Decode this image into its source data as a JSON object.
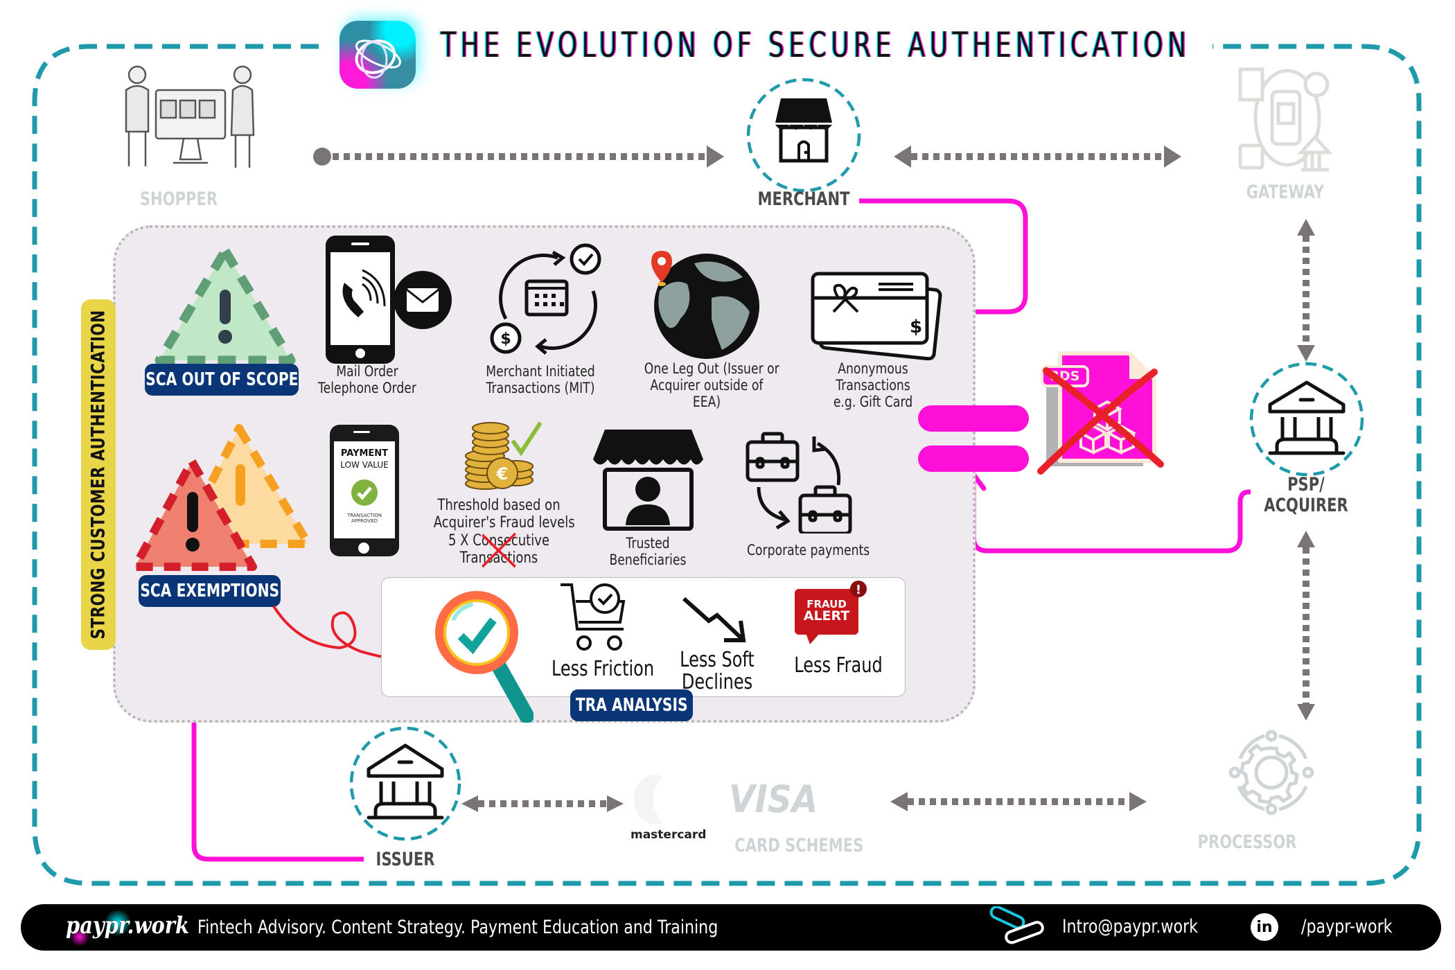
{
  "title": "THE EVOLUTION OF SECURE AUTHENTICATION",
  "colors": {
    "frame_teal": "#1f9aab",
    "flow_magenta": "#ff10d8",
    "badge_navy": "#0a3577",
    "sca_yellow": "#e8d548",
    "panel_bg": "#efeaf0",
    "faded_grey": "#cfd4d6",
    "arrow_grey": "#7a7474",
    "cross_red": "#e8202a"
  },
  "nodes": {
    "shopper": {
      "label": "SHOPPER",
      "icon": "shopper-icon",
      "state": "faded"
    },
    "merchant": {
      "label": "MERCHANT",
      "icon": "storefront-icon",
      "state": "active"
    },
    "gateway": {
      "label": "GATEWAY",
      "icon": "gateway-icon",
      "state": "faded"
    },
    "psp_acquirer": {
      "label_line1": "PSP/",
      "label_line2": "ACQUIRER",
      "icon": "bank-icon",
      "state": "active"
    },
    "processor": {
      "label": "PROCESSOR",
      "icon": "gear-cycle-icon",
      "state": "faded"
    },
    "card_schemes": {
      "label": "CARD SCHEMES",
      "mastercard": "mastercard",
      "visa": "VISA",
      "state": "faded"
    },
    "issuer": {
      "label": "ISSUER",
      "icon": "bank-icon",
      "state": "active"
    }
  },
  "sca": {
    "side_label": "STRONG CUSTOMER AUTHENTICATION",
    "out_of_scope": {
      "badge": "SCA OUT OF SCOPE",
      "items": [
        {
          "icon": "phone-mail-icon",
          "lines": [
            "Mail Order",
            "Telephone Order"
          ]
        },
        {
          "icon": "recurring-calendar-icon",
          "lines": [
            "Merchant Initiated",
            "Transactions (MIT)"
          ]
        },
        {
          "icon": "globe-pin-icon",
          "lines": [
            "One Leg Out (Issuer or",
            "Acquirer outside of",
            "EEA)"
          ]
        },
        {
          "icon": "gift-card-icon",
          "lines": [
            "Anonymous",
            "Transactions",
            "e.g. Gift Card"
          ]
        }
      ]
    },
    "exemptions": {
      "badge": "SCA EXEMPTIONS",
      "low_value_phone": {
        "title": "PAYMENT",
        "subtitle": "LOW VALUE",
        "status_line1": "TRANSACTION",
        "status_line2": "APPROVED"
      },
      "items": [
        {
          "icon": "euro-coins-icon",
          "lines": [
            "Threshold based on",
            "Acquirer's Fraud levels",
            "5 X Consecutive",
            "Transactions"
          ],
          "struck_out_lines": [
            "5 X Consecutive",
            "Transactions"
          ]
        },
        {
          "icon": "trusted-beneficiary-icon",
          "lines": [
            "Trusted",
            "Beneficiaries"
          ]
        },
        {
          "icon": "briefcase-exchange-icon",
          "lines": [
            "Corporate payments"
          ]
        }
      ]
    },
    "tra": {
      "badge": "TRA ANALYSIS",
      "benefits": [
        {
          "icon": "cart-check-icon",
          "label": "Less Friction"
        },
        {
          "icon": "trend-down-icon",
          "label_line1": "Less Soft",
          "label_line2": "Declines"
        },
        {
          "icon": "fraud-alert-icon",
          "label": "Less Fraud",
          "badge_line1": "FRAUD",
          "badge_line2": "ALERT"
        }
      ]
    }
  },
  "threeds": {
    "label": "3DS",
    "status": "crossed-out",
    "equals_sign": "="
  },
  "footer": {
    "brand": "paypr.work",
    "tagline": "Fintech Advisory. Content Strategy. Payment Education and  Training",
    "email": "Intro@paypr.work",
    "linkedin": "/paypr-work",
    "linkedin_icon_text": "in"
  }
}
